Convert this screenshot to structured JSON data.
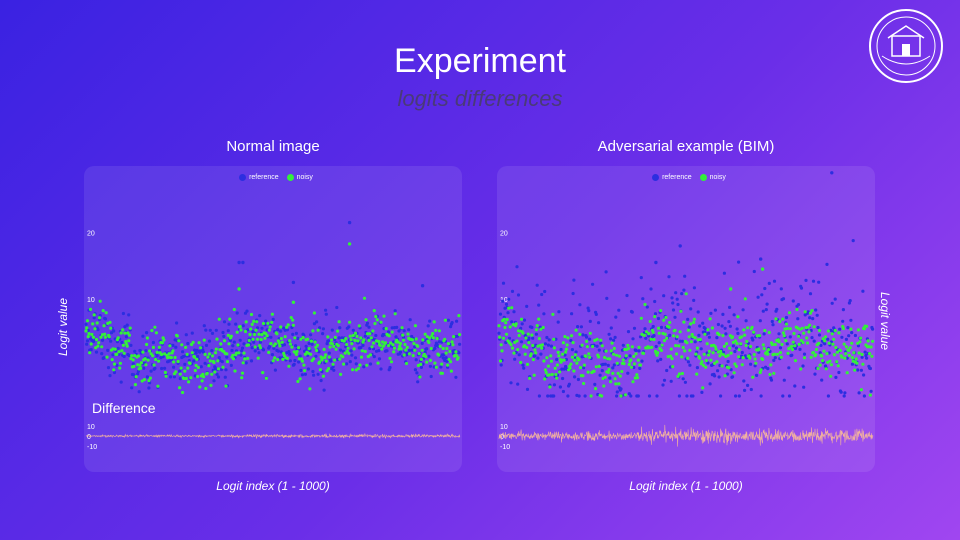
{
  "header": {
    "title": "Experiment",
    "subtitle": "logits differences"
  },
  "shared_labels": {
    "ylabel": "Logit value",
    "xlabel": "Logit index (1 - 1000)",
    "diff_label": "Difference"
  },
  "colors": {
    "reference": "#2c2ee0",
    "noisy": "#33f03a",
    "difference": "#f0b0a0"
  },
  "chart_data": [
    {
      "type": "scatter",
      "title": "Normal image",
      "xlabel": "Logit index (1 - 1000)",
      "ylabel": "Logit value",
      "xlim": [
        1,
        1000
      ],
      "ylim": [
        -4,
        24
      ],
      "yticks": [
        20,
        10
      ],
      "legend": {
        "placement": "top-center",
        "entries": [
          "reference",
          "noisy"
        ]
      },
      "series": [
        {
          "name": "reference",
          "color": "#2c2ee0",
          "noise_sd": 2.2,
          "outliers": [
            [
              705,
              21.5
            ],
            [
              410,
              15.5
            ],
            [
              420,
              15.5
            ],
            [
              555,
              12.5
            ],
            [
              900,
              12.0
            ]
          ]
        },
        {
          "name": "noisy",
          "color": "#33f03a",
          "noise_sd": 2.2,
          "outliers": [
            [
              705,
              18.3
            ],
            [
              410,
              11.5
            ],
            [
              555,
              9.5
            ]
          ]
        }
      ],
      "difference": {
        "yticks": [
          10,
          0,
          -10
        ],
        "amplitude": 0.8
      }
    },
    {
      "type": "scatter",
      "title": "Adversarial example (BIM)",
      "xlabel": "Logit index (1 - 1000)",
      "ylabel": "Logit value",
      "xlim": [
        1,
        1000
      ],
      "ylim": [
        -4,
        24
      ],
      "yticks": [
        20,
        10
      ],
      "legend": {
        "placement": "top-center",
        "entries": [
          "reference",
          "noisy"
        ]
      },
      "series": [
        {
          "name": "reference",
          "color": "#2c2ee0",
          "noise_sd": 4.5,
          "outliers": [
            [
              890,
              29.0
            ],
            [
              485,
              18.0
            ],
            [
              420,
              15.5
            ],
            [
              700,
              16.0
            ]
          ]
        },
        {
          "name": "noisy",
          "color": "#33f03a",
          "noise_sd": 2.2,
          "outliers": [
            [
              705,
              14.5
            ],
            [
              620,
              11.5
            ]
          ]
        }
      ],
      "difference": {
        "yticks": [
          10,
          0,
          -10
        ],
        "amplitude": 3.5
      }
    }
  ]
}
